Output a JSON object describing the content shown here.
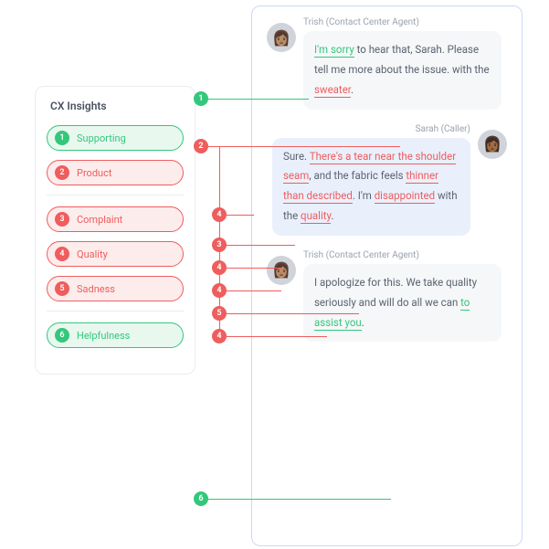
{
  "sidebar": {
    "title": "CX Insights",
    "groups": [
      [
        {
          "n": "1",
          "label": "Supporting",
          "tone": "g"
        },
        {
          "n": "2",
          "label": "Product",
          "tone": "r"
        }
      ],
      [
        {
          "n": "3",
          "label": "Complaint",
          "tone": "r"
        },
        {
          "n": "4",
          "label": "Quality",
          "tone": "r"
        },
        {
          "n": "5",
          "label": "Sadness",
          "tone": "r"
        }
      ],
      [
        {
          "n": "6",
          "label": "Helpfulness",
          "tone": "g"
        }
      ]
    ]
  },
  "chat": {
    "m1": {
      "name": "Trish (Contact Center Agent)",
      "t0": "I'm sorry",
      "t1": " to hear that, Sarah. Please tell me more about the issue. with the ",
      "t2": "sweater",
      "t3": "."
    },
    "m2": {
      "name": "Sarah (Caller)",
      "t0": "Sure. ",
      "t1": "There's a tear near the shoulder seam",
      "t2": ", and the fabric feels ",
      "t3": "thinner than described",
      "t4": ". I'm ",
      "t5": "disappointed",
      "t6": " with the ",
      "t7": "quality",
      "t8": "."
    },
    "m3": {
      "name": "Trish (Contact Center Agent)",
      "t0": "I apologize for this. We take quality seriously and will do all we can ",
      "t1": "to assist you",
      "t2": "."
    }
  },
  "annotations": {
    "a1": "1",
    "a2": "2",
    "a3": "3",
    "a4a": "4",
    "a4b": "4",
    "a4c": "4",
    "a4d": "4",
    "a5": "5",
    "a6": "6"
  }
}
